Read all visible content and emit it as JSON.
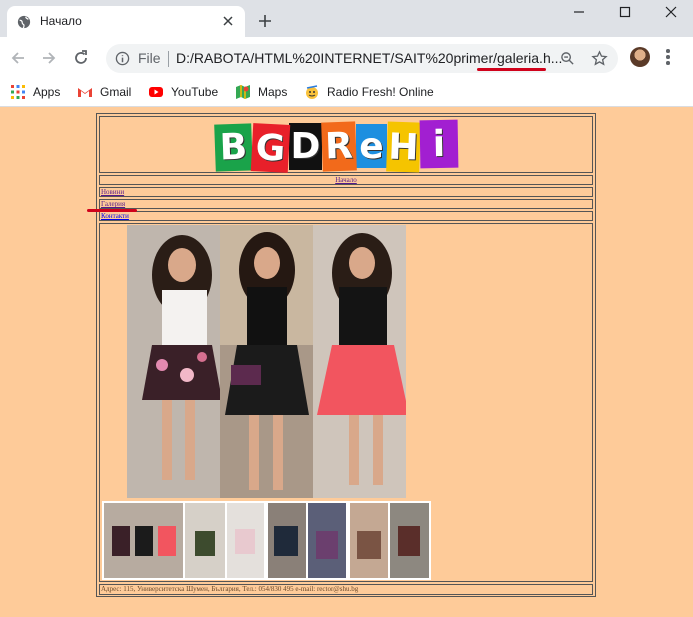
{
  "browser": {
    "tab_title": "Начало",
    "omnibox_file": "File",
    "omnibox_url": "D:/RABOTA/HTML%20INTERNET/SAIT%20primer/galeria.h...",
    "bookmarks": [
      {
        "label": "Apps",
        "icon": "apps-grid-icon"
      },
      {
        "label": "Gmail",
        "icon": "gmail-icon"
      },
      {
        "label": "YouTube",
        "icon": "youtube-icon"
      },
      {
        "label": "Maps",
        "icon": "maps-icon"
      },
      {
        "label": "Radio Fresh! Online",
        "icon": "radio-fresh-icon"
      }
    ]
  },
  "site": {
    "logo_letters": [
      "B",
      "G",
      "D",
      "R",
      "e",
      "H",
      "i"
    ],
    "logo_colors": [
      "#1aa34a",
      "#e8202a",
      "#111111",
      "#f26a1b",
      "#1d8fe0",
      "#f5c400",
      "#a21fd1"
    ],
    "nav": {
      "home": "Начало",
      "news": "Новини",
      "gallery": "Галерия",
      "contacts": "Контакти"
    },
    "footer": "Адрес: 115, Университетска Шумен, България, Тел.: 054/830 495 e-mail: rector@shu.bg"
  }
}
